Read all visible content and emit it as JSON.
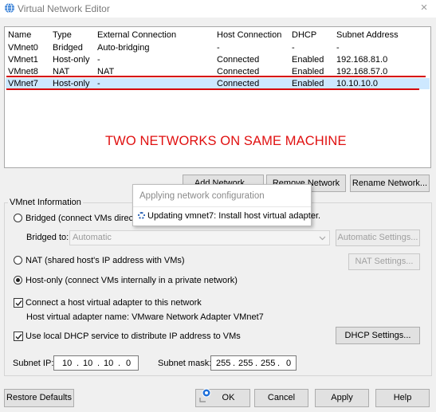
{
  "window": {
    "title": "Virtual Network Editor",
    "close_glyph": "×"
  },
  "table": {
    "headers": [
      "Name",
      "Type",
      "External Connection",
      "Host Connection",
      "DHCP",
      "Subnet Address"
    ],
    "rows": [
      [
        "VMnet0",
        "Bridged",
        "Auto-bridging",
        "-",
        "-",
        "-"
      ],
      [
        "VMnet1",
        "Host-only",
        "-",
        "Connected",
        "Enabled",
        "192.168.81.0"
      ],
      [
        "VMnet8",
        "NAT",
        "NAT",
        "Connected",
        "Enabled",
        "192.168.57.0"
      ],
      [
        "VMnet7",
        "Host-only",
        "-",
        "Connected",
        "Enabled",
        "10.10.10.0"
      ]
    ],
    "selected_row": 3
  },
  "annotation": {
    "text": "TWO NETWORKS ON SAME MACHINE",
    "color": "#e01010"
  },
  "buttons": {
    "add_network": "Add Network...",
    "remove_network": "Remove Network",
    "rename_network": "Rename Network...",
    "automatic_settings": "Automatic Settings...",
    "nat_settings": "NAT Settings...",
    "dhcp_settings": "DHCP Settings...",
    "restore_defaults": "Restore Defaults",
    "ok": "OK",
    "cancel": "Cancel",
    "apply": "Apply",
    "help": "Help"
  },
  "vmnet_info": {
    "group_label": "VMnet Information",
    "bridged_label": "Bridged (connect VMs directly to the external network)",
    "bridged_to_label": "Bridged to:",
    "bridged_to_value": "Automatic",
    "nat_label": "NAT (shared host's IP address with VMs)",
    "hostonly_label": "Host-only (connect VMs internally in a private network)",
    "selected_mode": "host-only",
    "connect_adapter_label": "Connect a host virtual adapter to this network",
    "connect_adapter_checked": true,
    "adapter_name_text": "Host virtual adapter name: VMware Network Adapter VMnet7",
    "dhcp_label": "Use local DHCP service to distribute IP address to VMs",
    "dhcp_checked": true
  },
  "subnet": {
    "ip_label": "Subnet IP:",
    "ip": [
      "10",
      "10",
      "10",
      "0"
    ],
    "mask_label": "Subnet mask:",
    "mask": [
      "255",
      "255",
      "255",
      "0"
    ]
  },
  "popup": {
    "title": "Applying network configuration",
    "message": "Updating vmnet7: Install host virtual adapter."
  },
  "icons": {
    "title_icon": "network-globe-icon",
    "ok_icon": "admin-shield-icon",
    "spinner": "busy-spinner-icon"
  },
  "colors": {
    "accent": "#2a62b5",
    "selection": "#cde8ff",
    "annotation_line": "#d60000"
  }
}
